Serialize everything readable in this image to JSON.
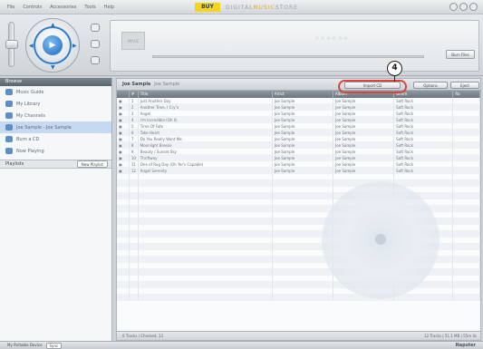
{
  "app": {
    "menu": [
      "File",
      "Controls",
      "Accessories",
      "Tools",
      "Help"
    ],
    "brand_logo": "BUY",
    "store_name_part1": "DIGITAL",
    "store_name_part2": "MUSIC",
    "store_name_part3": "STORE"
  },
  "player": {
    "rating": "☆☆☆☆☆☆",
    "album_art_label": "IMAGE",
    "burn_button": "Burn Files"
  },
  "sidebar": {
    "header": "Browse",
    "items": [
      {
        "label": "Music Guide",
        "icon": "music-guide-icon"
      },
      {
        "label": "My Library",
        "icon": "library-icon"
      },
      {
        "label": "My Channels",
        "icon": "channels-icon"
      },
      {
        "label": "Joe Sample - Joe Sample",
        "icon": "album-icon"
      },
      {
        "label": "Burn a CD",
        "icon": "burn-cd-icon"
      },
      {
        "label": "Now Playing",
        "icon": "now-playing-icon"
      }
    ],
    "playlists_label": "Playlists",
    "new_playlist_button": "New Playlist"
  },
  "main": {
    "crumb": "Joe Sample",
    "crumb_sub": "Joe Sample",
    "toolbar": {
      "import_button": "Import CD",
      "options_button": "Options",
      "eject_button": "Eject"
    },
    "columns": [
      "",
      "#",
      "Title",
      "Artist",
      "Album",
      "Genre",
      "Ra"
    ],
    "tracks": [
      {
        "no": "1",
        "title": "Just Another Day",
        "artist": "Joe Sample",
        "album": "Joe Sample",
        "genre": "Soft Rock"
      },
      {
        "no": "2",
        "title": "Another Time, I Cry'n",
        "artist": "Joe Sample",
        "album": "Joe Sample",
        "genre": "Soft Rock"
      },
      {
        "no": "3",
        "title": "Angel",
        "artist": "Joe Sample",
        "album": "Joe Sample",
        "genre": "Soft Rock"
      },
      {
        "no": "4",
        "title": "I'm Incredible (Oh Il)",
        "artist": "Joe Sample",
        "album": "Joe Sample",
        "genre": "Soft Rock"
      },
      {
        "no": "5",
        "title": "Time Of Fate",
        "artist": "Joe Sample",
        "album": "Joe Sample",
        "genre": "Soft Rock"
      },
      {
        "no": "6",
        "title": "Take Heart",
        "artist": "Joe Sample",
        "album": "Joe Sample",
        "genre": "Soft Rock"
      },
      {
        "no": "7",
        "title": "Do You Really Want Me",
        "artist": "Joe Sample",
        "album": "Joe Sample",
        "genre": "Soft Rock"
      },
      {
        "no": "8",
        "title": "Moonlight Breeze",
        "artist": "Joe Sample",
        "album": "Joe Sample",
        "genre": "Soft Rock"
      },
      {
        "no": "9",
        "title": "Beauty / Sunset Sky",
        "artist": "Joe Sample",
        "album": "Joe Sample",
        "genre": "Soft Rock"
      },
      {
        "no": "10",
        "title": "Thriftway",
        "artist": "Joe Sample",
        "album": "Joe Sample",
        "genre": "Soft Rock"
      },
      {
        "no": "11",
        "title": "One of Rug Day (Oh Yer's Capable)",
        "artist": "Joe Sample",
        "album": "Joe Sample",
        "genre": "Soft Rock"
      },
      {
        "no": "12",
        "title": "Angel Serenity",
        "artist": "Joe Sample",
        "album": "Joe Sample",
        "genre": "Soft Rock"
      }
    ],
    "footer_left": "0 Tracks | Checked: 12",
    "footer_right": "12 Tracks | 51.1 MB | 55m 4s"
  },
  "bottom": {
    "left_label": "My Portable Device",
    "left_button": "Sync",
    "right_label": "Napster"
  },
  "annotation": {
    "callout_number": "4"
  }
}
